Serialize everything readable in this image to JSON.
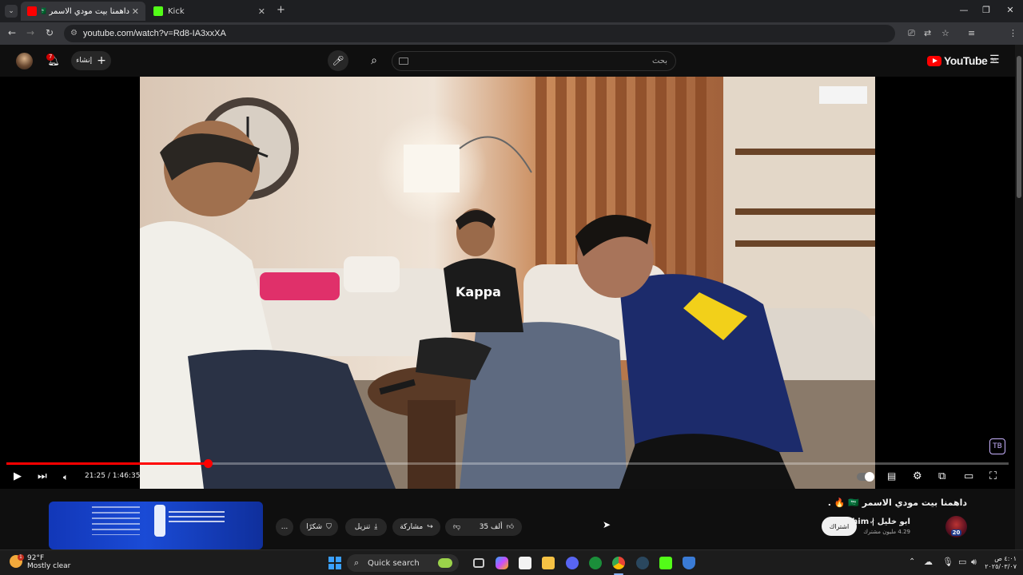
{
  "browser": {
    "tabs": [
      {
        "title": "داهمنا بيت مودي الاسمر 🇸🇦 |",
        "active": true
      },
      {
        "title": "Kick",
        "active": false
      }
    ],
    "url": "youtube.com/watch?v=Rd8-IA3xxXA",
    "new_tab_label": "+"
  },
  "youtube": {
    "logo_text": "YouTube",
    "region": "SA",
    "search_placeholder": "بحث",
    "create_label": "إنشاء",
    "notification_count": "7"
  },
  "player": {
    "current_time": "21:25",
    "duration": "1:46:35",
    "progress_fraction": 0.2009,
    "watermark": "TB"
  },
  "video": {
    "title": "داهمنا بيت مودي الاسمر 🇸🇦 🔥 .",
    "channel_name": "ابو خليل | Ibrahim",
    "subscriber_count": "4.29 مليون مشترك",
    "subscribe_label": "اشتراك",
    "like_count": "35 ألف",
    "share_label": "مشاركة",
    "download_label": "تنزيل",
    "thanks_label": "شكرًا",
    "more_label": "...",
    "avatar_badge": "20"
  },
  "taskbar": {
    "weather_temp": "92°F",
    "weather_text": "Mostly clear",
    "weather_badge": "1",
    "search_label": "Quick search",
    "time": "٤:٠١ ص",
    "date": "٢٠٢٥/٠٣/٠٧"
  }
}
